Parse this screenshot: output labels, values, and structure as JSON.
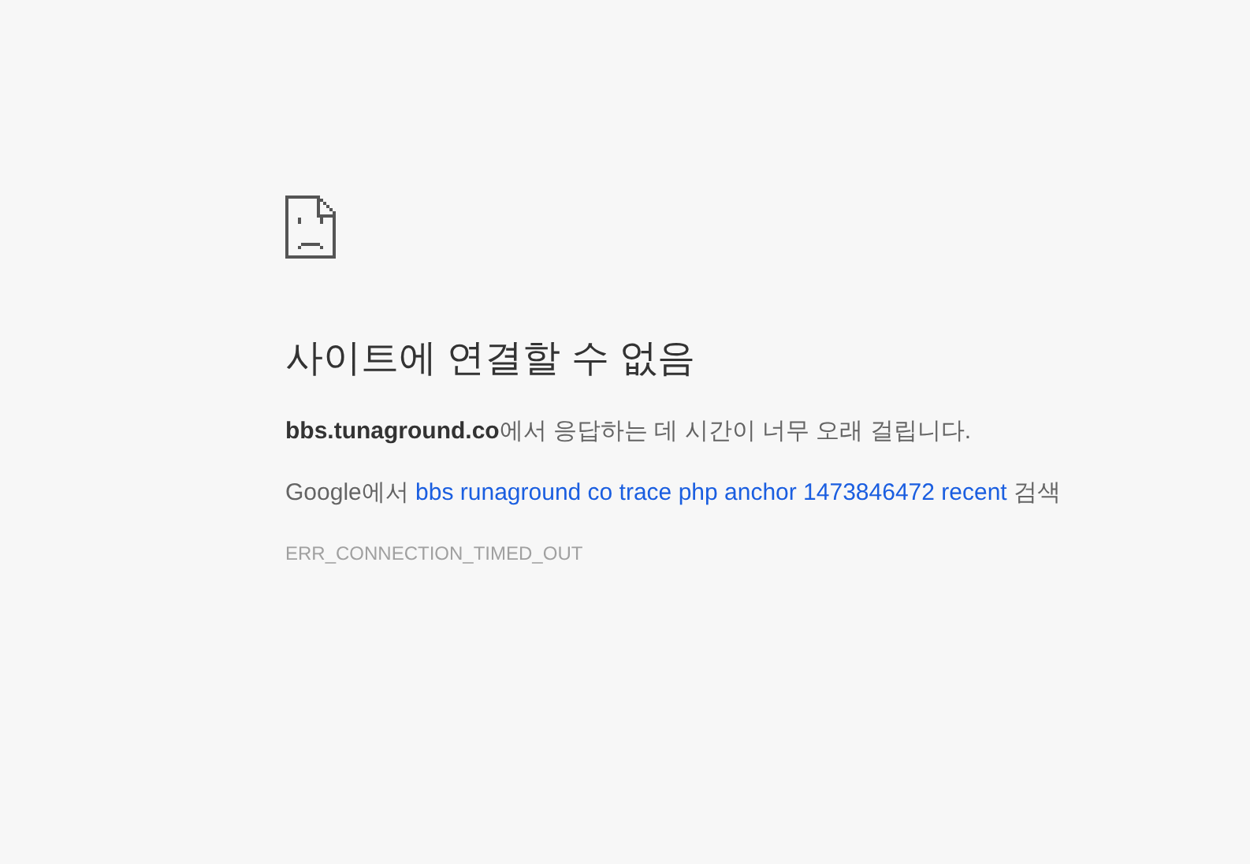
{
  "title": "사이트에 연결할 수 없음",
  "message": "**bbs.tunaground.co**에서 응답하는 데 시간이 너무 오래 걸립니다.",
  "suggestion": {
    "prefix": "Google에서",
    "link": "bbs runaground co trace php anchor 1473846472 recent",
    "suffix": "검색"
  },
  "error_code": "ERR_CONNECTION_TIMED_OUT"
}
